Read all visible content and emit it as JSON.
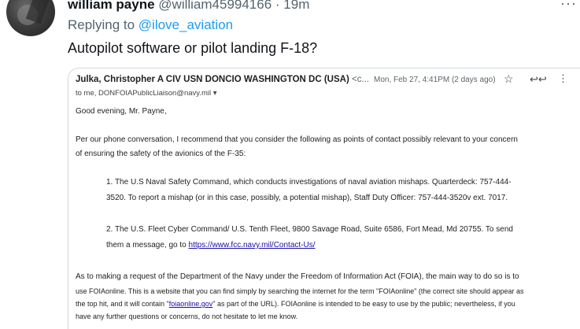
{
  "tweet": {
    "author_name": "william payne",
    "author_handle": "@william45994166",
    "separator": " · ",
    "time": "19m",
    "more_menu": "···",
    "replying_prefix": "Replying to ",
    "replying_to": "@ilove_aviation",
    "text": "Autopilot software or pilot landing F-18?"
  },
  "email": {
    "sender": "Julka, Christopher A CIV USN DONCIO WASHINGTON DC (USA)",
    "sender_suffix": " <c...",
    "date": "Mon, Feb 27, 4:41PM (2 days ago)",
    "to_line": "to me, DONFOIAPublicLiaison@navy.mil ▾",
    "greeting": "Good evening, Mr. Payne,",
    "para1_line1": "Per our phone conversation, I recommend that you consider the following as points of contact possibly relevant to your concern",
    "para1_line2": "of ensuring the safety of the avionics of the F-35:",
    "item1_line1": "1.    The U.S Naval Safety Command, which conducts investigations of naval aviation mishaps.  Quarterdeck: 757-444-",
    "item1_line2": "3520.  To report a mishap (or in this case, possibly, a potential mishap), Staff Duty Officer: 757-444-3520v ext. 7017.",
    "item2_line1": "2.    The U.S. Fleet Cyber Command/ U.S. Tenth Fleet, 9800 Savage Road, Suite 6586, Fort Mead, Md 20755.  To send",
    "item2_line2_prefix": "them a message, go to ",
    "item2_link": "https://www.fcc.navy.mil/Contact-Us/",
    "para3_line1": "As to making a request of the Department of the Navy under the Freedom of Information Act (FOIA), the main way to do so is to",
    "para3_line2": "use FOIAonline.  This is a website that you can find simply by searching the internet for the term \"FOIAonline\" (the correct site should appear as",
    "para3_line3_prefix": "the top hit, and it will contain \"",
    "para3_link": "foiaonline.gov",
    "para3_line3_suffix": "\" as part of the URL).  FOIAonline is intended to be easy to use by the public; nevertheless, if you",
    "para3_line4": "have any further questions or concerns, do not hesitate to let me know."
  }
}
